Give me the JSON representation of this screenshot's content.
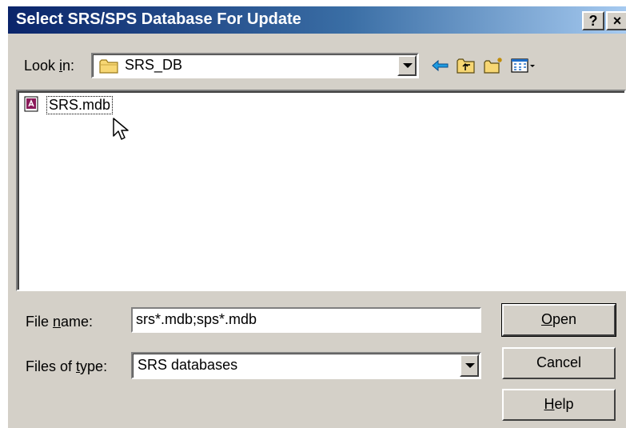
{
  "window": {
    "title": "Select SRS/SPS Database For Update",
    "help_button": "?",
    "close_button": "×"
  },
  "lookin": {
    "label_prefix": "Look ",
    "label_hotkey": "i",
    "label_suffix": "n:",
    "value": "SRS_DB",
    "folder_icon": "folder-icon"
  },
  "toolbar": {
    "icons": [
      "back-arrow-icon",
      "up-folder-icon",
      "new-folder-icon",
      "view-menu-icon"
    ]
  },
  "files": [
    {
      "name": "SRS.mdb",
      "icon": "access-database-icon"
    }
  ],
  "filename": {
    "label_prefix": "File ",
    "label_hotkey": "n",
    "label_suffix": "ame:",
    "value": "srs*.mdb;sps*.mdb"
  },
  "filetype": {
    "label_prefix": "Files of ",
    "label_hotkey": "t",
    "label_suffix": "ype:",
    "value": "SRS databases"
  },
  "buttons": {
    "open_hotkey": "O",
    "open_rest": "pen",
    "cancel": "Cancel",
    "help_hotkey": "H",
    "help_rest": "elp"
  }
}
